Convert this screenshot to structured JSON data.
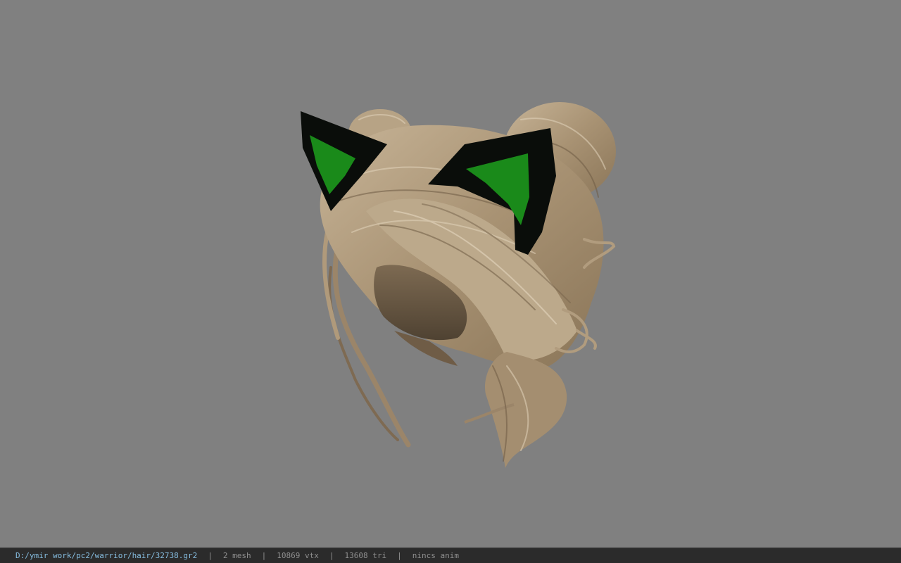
{
  "viewer": {
    "background_color": "#808080",
    "model": {
      "subject": "hair-with-cat-ears",
      "hair_color": "#b39e80",
      "ear_outer_color": "#0a0d0a",
      "ear_inner_color": "#1a8a1a"
    }
  },
  "status_bar": {
    "file_path": "D:/ymir work/pc2/warrior/hair/32738.gr2",
    "separator": "|",
    "mesh_count": "2 mesh",
    "vertex_count": "10869 vtx",
    "triangle_count": "13608 tri",
    "anim_status": "nincs anim",
    "path_color": "#86bde0",
    "text_color": "#8f8f8f"
  }
}
